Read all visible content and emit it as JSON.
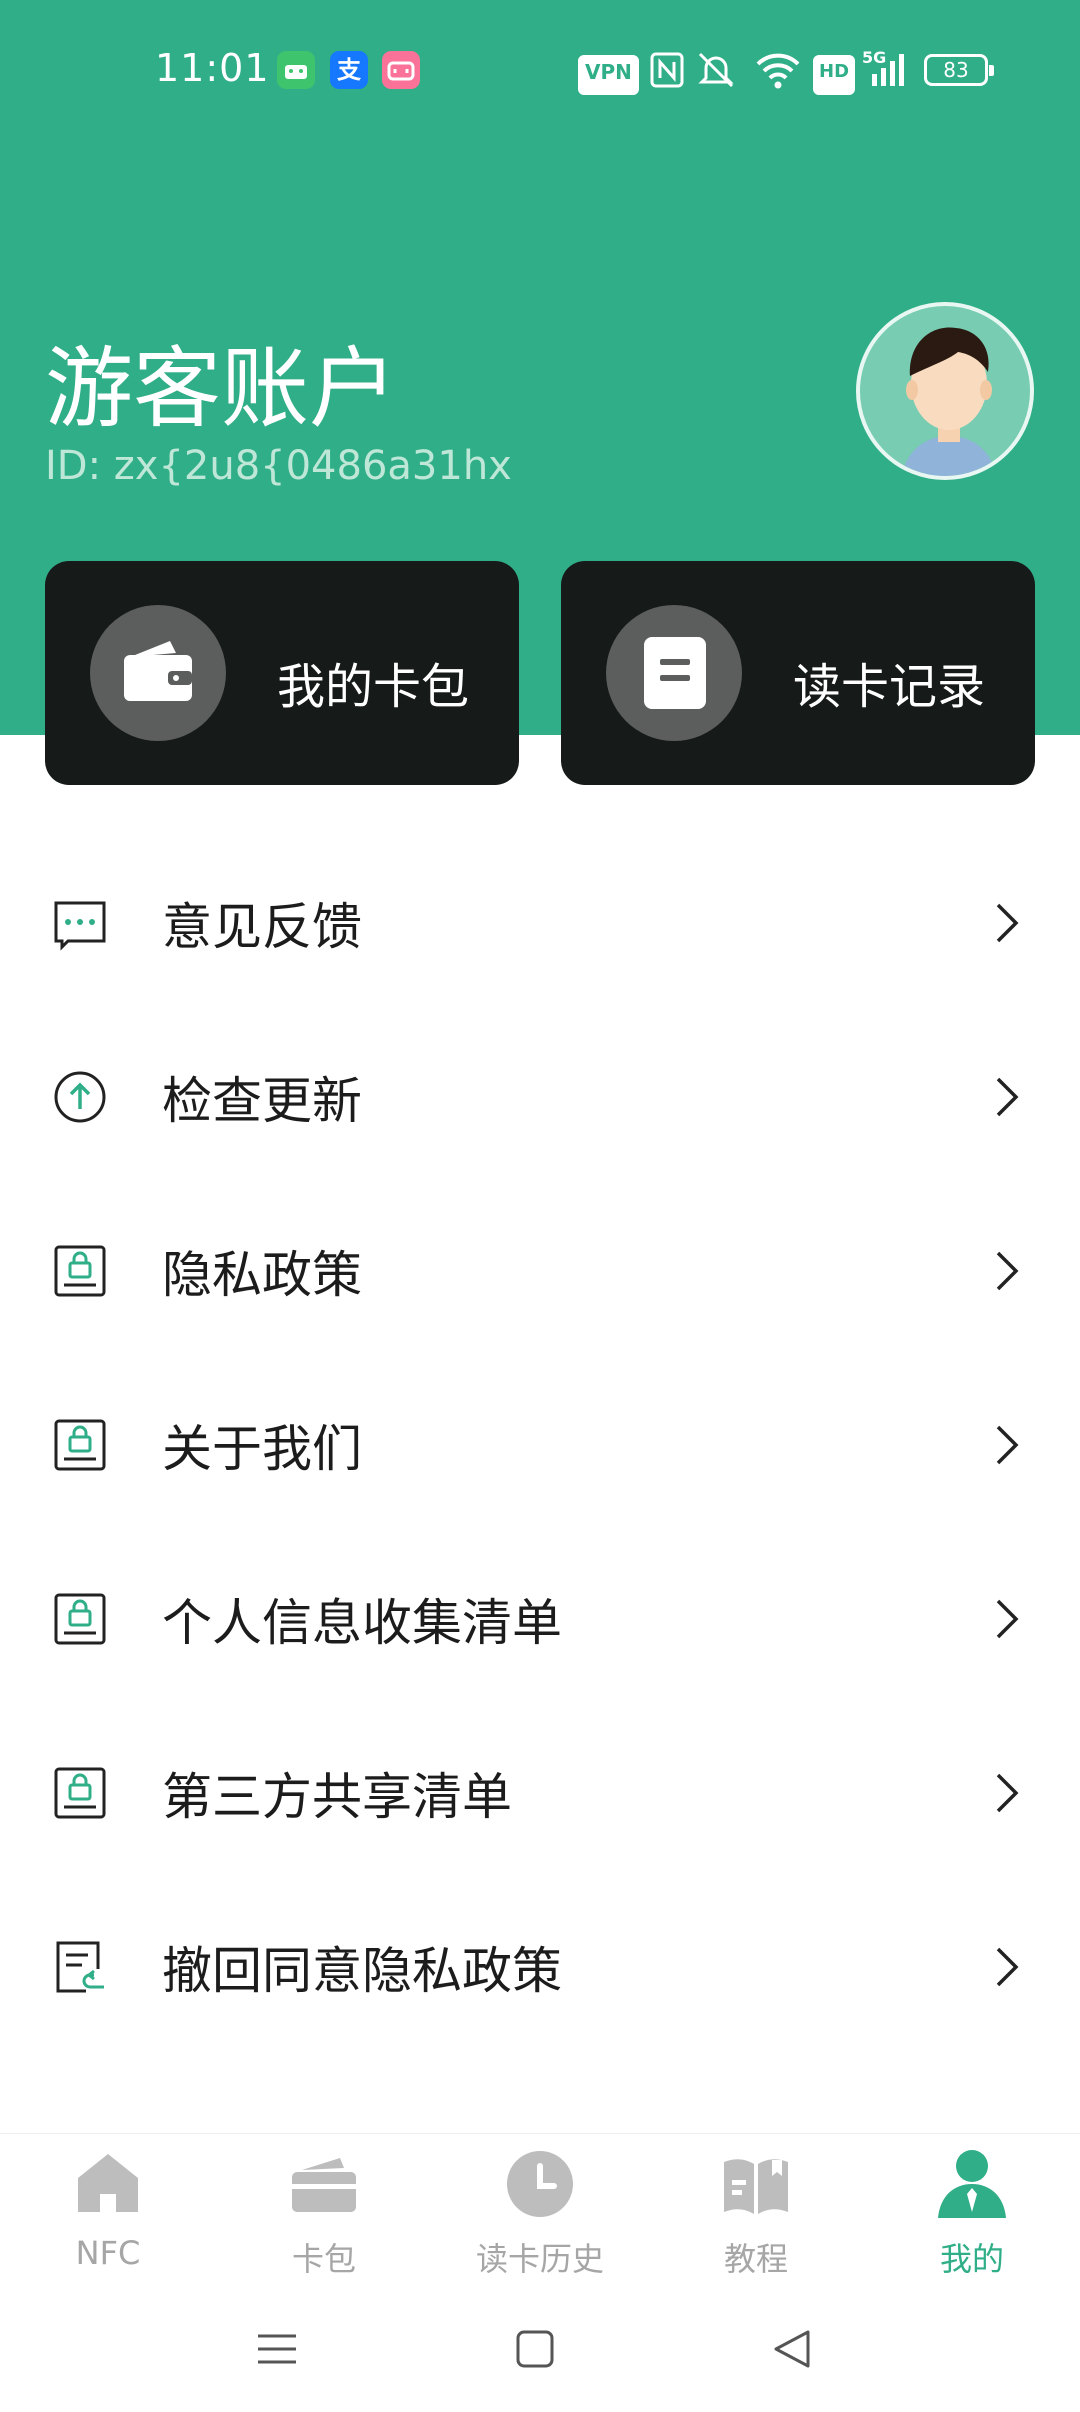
{
  "status_bar": {
    "time": "11:01",
    "vpn": "VPN",
    "network": "5G",
    "battery": "83",
    "hd": "HD",
    "app_icons": [
      "android-app-icon",
      "alipay-icon",
      "bilibili-icon"
    ]
  },
  "profile": {
    "name": "游客账户",
    "id": "ID: zx{2u8{0486a31hx"
  },
  "actions": [
    {
      "label": "我的卡包",
      "icon": "wallet-icon"
    },
    {
      "label": "读卡记录",
      "icon": "document-icon"
    }
  ],
  "menu": [
    {
      "label": "意见反馈",
      "icon": "feedback-icon"
    },
    {
      "label": "检查更新",
      "icon": "update-icon"
    },
    {
      "label": "隐私政策",
      "icon": "privacy-lock-icon"
    },
    {
      "label": "关于我们",
      "icon": "privacy-lock-icon"
    },
    {
      "label": "个人信息收集清单",
      "icon": "privacy-lock-icon"
    },
    {
      "label": "第三方共享清单",
      "icon": "privacy-lock-icon"
    },
    {
      "label": "撤回同意隐私政策",
      "icon": "revoke-icon"
    }
  ],
  "tabs": [
    {
      "label": "NFC",
      "icon": "home-icon",
      "active": false
    },
    {
      "label": "卡包",
      "icon": "card-wallet-icon",
      "active": false
    },
    {
      "label": "读卡历史",
      "icon": "clock-icon",
      "active": false
    },
    {
      "label": "教程",
      "icon": "book-icon",
      "active": false
    },
    {
      "label": "我的",
      "icon": "person-icon",
      "active": true
    }
  ],
  "colors": {
    "brand": "#2fae88",
    "card_bg": "#161a19",
    "inactive_tab": "#a6a6a6"
  }
}
